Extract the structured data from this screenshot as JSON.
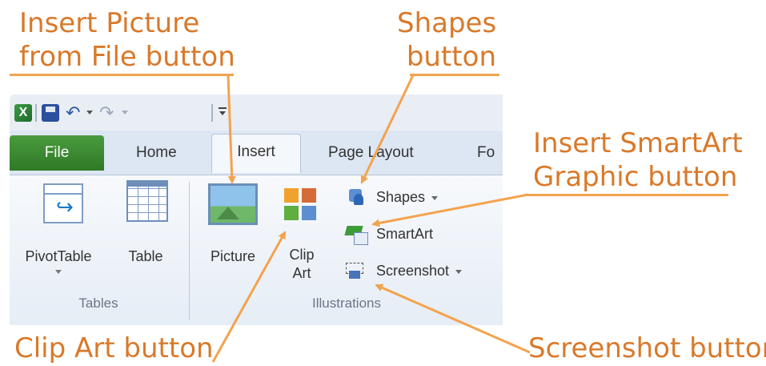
{
  "callouts": {
    "insert_picture": [
      "Insert Picture",
      "from File button"
    ],
    "shapes": [
      "Shapes",
      "button"
    ],
    "smartart": [
      "Insert SmartArt",
      "Graphic button"
    ],
    "clip_art": "Clip Art button",
    "screenshot": "Screenshot button"
  },
  "qat": {
    "app_icon": "X",
    "icons": [
      "excel-icon",
      "save-icon",
      "undo-icon",
      "redo-icon",
      "customize-qat-icon"
    ]
  },
  "tabs": {
    "file": "File",
    "home": "Home",
    "insert": "Insert",
    "page_layout": "Page Layout",
    "formulas_partial": "Fo"
  },
  "ribbon": {
    "pivottable": "PivotTable",
    "table": "Table",
    "picture": "Picture",
    "clip_art": [
      "Clip",
      "Art"
    ],
    "shapes": "Shapes",
    "smartart": "SmartArt",
    "screenshot": "Screenshot",
    "group_tables": "Tables",
    "group_illustrations": "Illustrations"
  },
  "colors": {
    "callout_text": "#d9792a",
    "arrow": "#f3a34e",
    "file_tab": "#3b8a31"
  }
}
